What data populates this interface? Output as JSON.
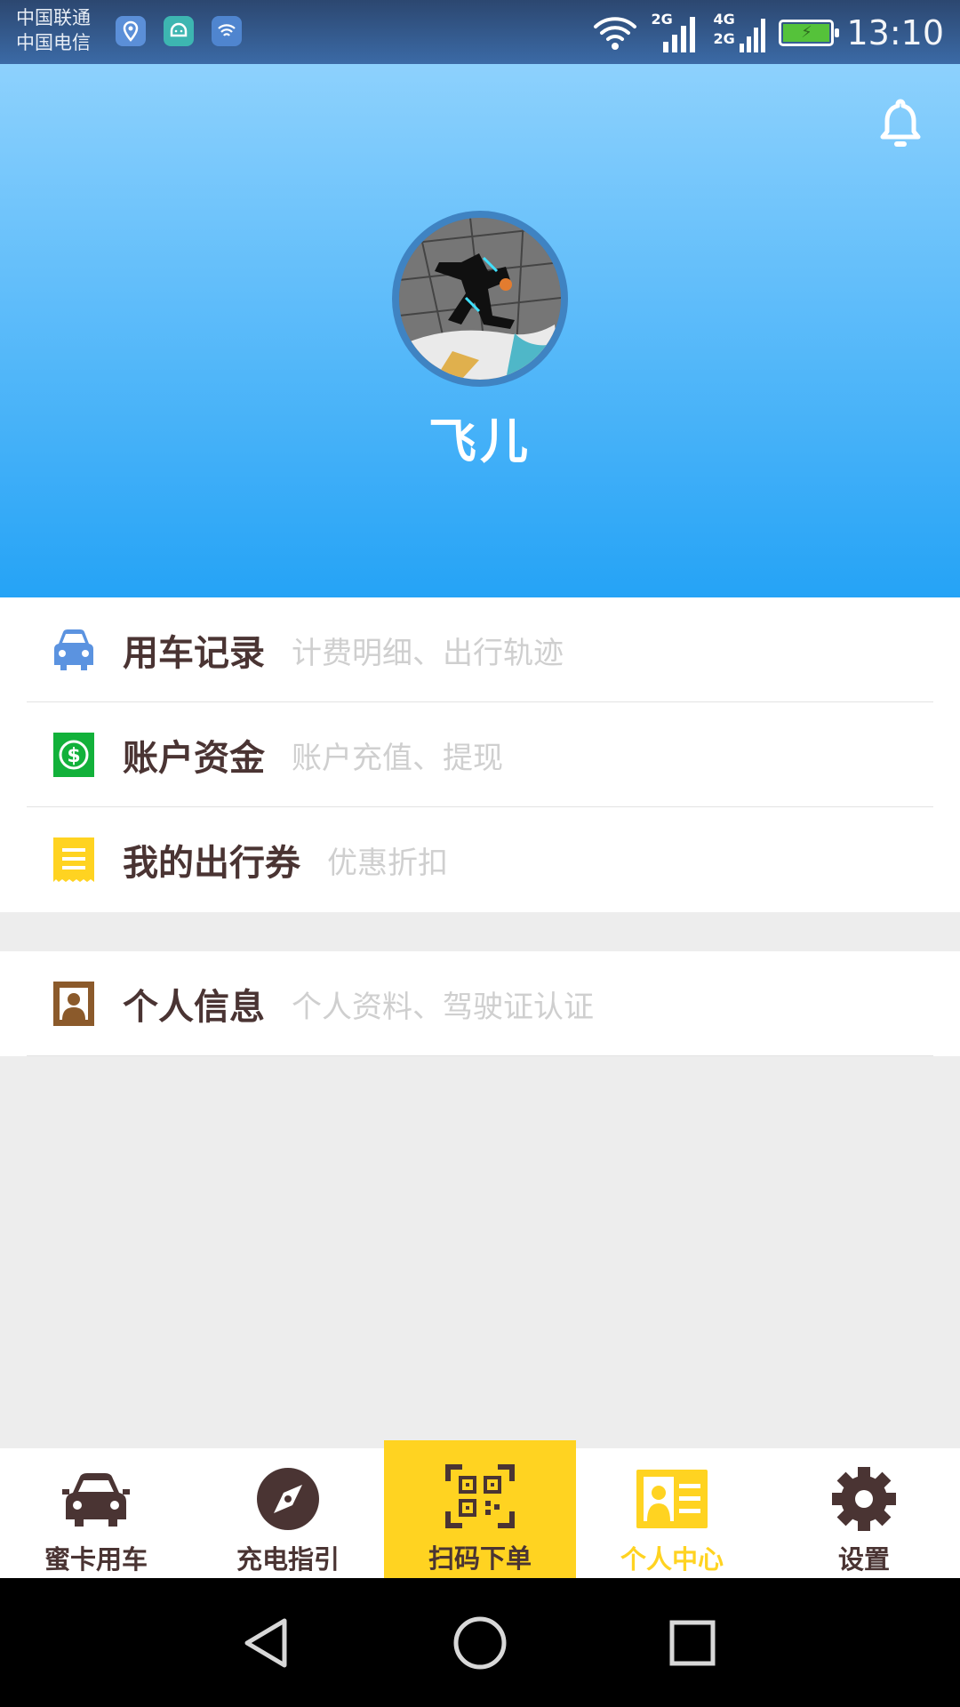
{
  "status_bar": {
    "carrier_1": "中国联通",
    "carrier_2": "中国电信",
    "signal_1_label": "2G",
    "signal_2_label_top": "4G",
    "signal_2_label_bottom": "2G",
    "time": "13:10",
    "icons": [
      "location-icon",
      "android-icon",
      "wifi-share-icon",
      "wifi-icon",
      "signal-icon",
      "battery-icon"
    ]
  },
  "profile": {
    "username": "飞儿",
    "avatar": "avatar-image"
  },
  "menu": {
    "group_1": [
      {
        "title": "用车记录",
        "subtitle": "计费明细、出行轨迹",
        "icon": "car-icon",
        "icon_color": "#5b93e0"
      },
      {
        "title": "账户资金",
        "subtitle": "账户充值、提现",
        "icon": "money-icon",
        "icon_color": "#12b13a"
      },
      {
        "title": "我的出行券",
        "subtitle": "优惠折扣",
        "icon": "coupon-icon",
        "icon_color": "#ffd321"
      }
    ],
    "group_2": [
      {
        "title": "个人信息",
        "subtitle": "个人资料、驾驶证认证",
        "icon": "id-card-icon",
        "icon_color": "#8b5a2b"
      }
    ]
  },
  "bottom_nav": [
    {
      "label": "蜜卡用车",
      "icon": "car-icon"
    },
    {
      "label": "充电指引",
      "icon": "compass-icon"
    },
    {
      "label": "扫码下单",
      "icon": "qr-scan-icon"
    },
    {
      "label": "个人中心",
      "icon": "profile-card-icon",
      "active": true
    },
    {
      "label": "设置",
      "icon": "gear-icon"
    }
  ],
  "colors": {
    "accent": "#ffd321",
    "header_top": "#8dd1fd",
    "header_bottom": "#25a3f6",
    "text_dark": "#4a3433",
    "text_muted": "#cfcfcf"
  }
}
